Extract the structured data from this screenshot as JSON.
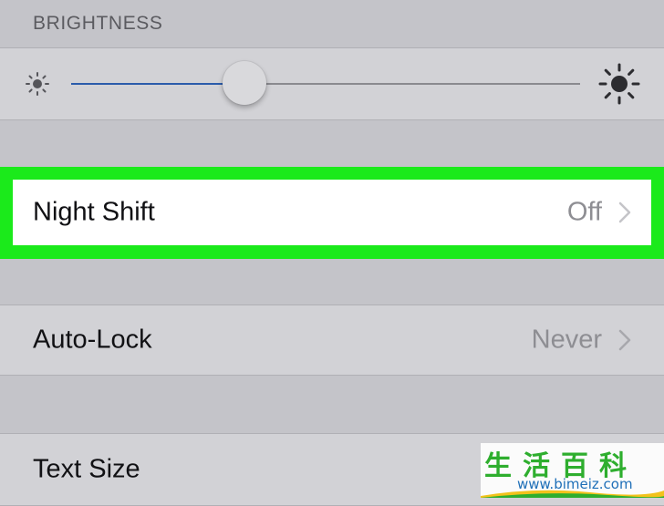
{
  "brightness": {
    "header": "BRIGHTNESS",
    "level": 0.34,
    "colors": {
      "track_fill": "#2b5cab",
      "track": "#8a8a8f"
    }
  },
  "rows": [
    {
      "label": "Night Shift",
      "value": "Off",
      "highlighted": true
    },
    {
      "label": "Auto-Lock",
      "value": "Never"
    },
    {
      "label": "Text Size",
      "value": ""
    }
  ],
  "highlight_color": "#1bea1b",
  "icons": {
    "brightness_low": "sun-small-icon",
    "brightness_high": "sun-large-icon",
    "disclosure": "chevron-right-icon"
  },
  "watermark": {
    "title": "生活百科",
    "url": "www.bimeiz.com"
  }
}
